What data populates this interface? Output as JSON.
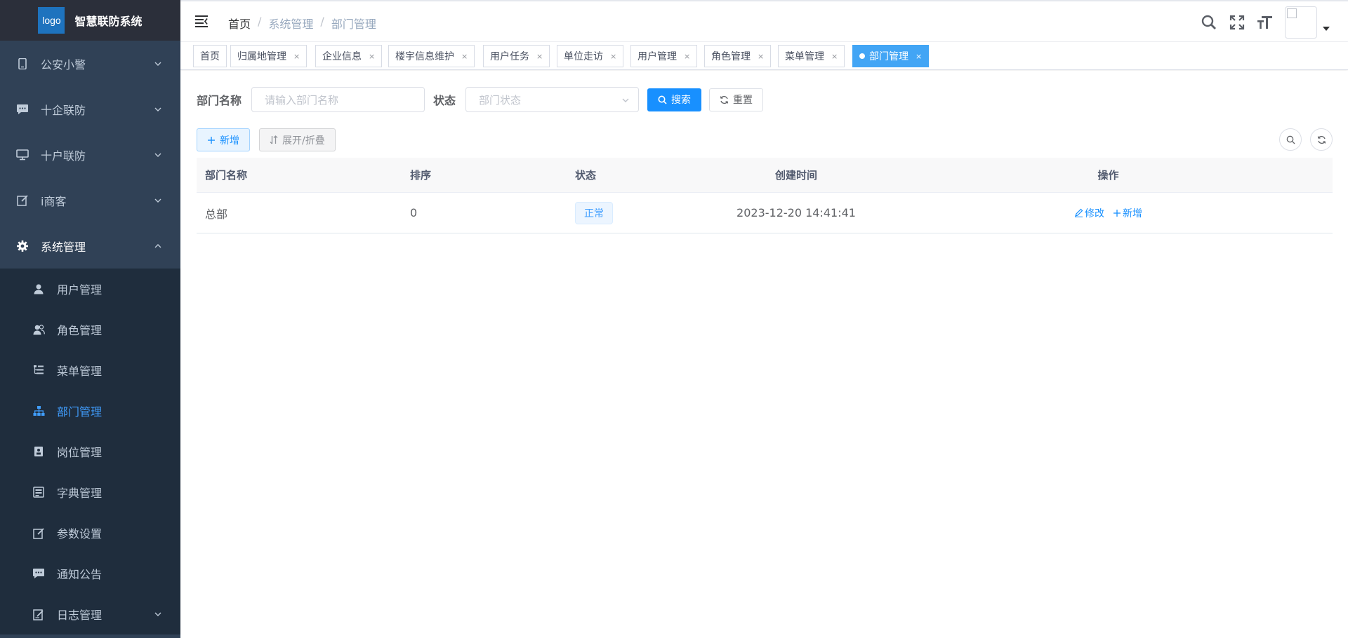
{
  "brand": {
    "logo_text": "logo",
    "title": "智慧联防系统"
  },
  "sidebar": {
    "groups": [
      {
        "label": "公安小警",
        "icon": "phone-icon"
      },
      {
        "label": "十企联防",
        "icon": "chat-icon"
      },
      {
        "label": "十户联防",
        "icon": "monitor-icon"
      },
      {
        "label": "i商客",
        "icon": "edit-icon"
      },
      {
        "label": "系统管理",
        "icon": "gear-icon"
      }
    ],
    "sub_items": [
      {
        "label": "用户管理",
        "icon": "user-icon"
      },
      {
        "label": "角色管理",
        "icon": "users-icon"
      },
      {
        "label": "菜单管理",
        "icon": "tree-table-icon"
      },
      {
        "label": "部门管理",
        "icon": "org-tree-icon"
      },
      {
        "label": "岗位管理",
        "icon": "post-icon"
      },
      {
        "label": "字典管理",
        "icon": "dict-icon"
      },
      {
        "label": "参数设置",
        "icon": "edit-icon"
      },
      {
        "label": "通知公告",
        "icon": "message-icon"
      },
      {
        "label": "日志管理",
        "icon": "log-icon"
      }
    ],
    "active_color": "#409eff",
    "bg_color": "#304156"
  },
  "breadcrumb": {
    "items": [
      "首页",
      "系统管理",
      "部门管理"
    ],
    "separator": "/"
  },
  "tags": {
    "items": [
      "首页",
      "归属地管理",
      "企业信息",
      "楼宇信息维护",
      "用户任务",
      "单位走访",
      "用户管理",
      "角色管理",
      "菜单管理",
      "部门管理"
    ],
    "close_glyph": "×",
    "active_color": "#42a5f5"
  },
  "search_form": {
    "dept_name_label": "部门名称",
    "dept_name_placeholder": "请输入部门名称",
    "status_label": "状态",
    "status_placeholder": "部门状态",
    "search_button": "搜索",
    "reset_button": "重置"
  },
  "toolbar": {
    "add_button": "新增",
    "expand_button": "展开/折叠"
  },
  "table": {
    "columns": [
      "部门名称",
      "排序",
      "状态",
      "创建时间",
      "操作"
    ],
    "rows": [
      {
        "name": "总部",
        "order": "0",
        "status": "正常",
        "created": "2023-12-20 14:41:41",
        "edit": "修改",
        "add": "新增"
      }
    ]
  },
  "colors": {
    "primary": "#1890ff",
    "tag_active": "#42a5f5"
  }
}
